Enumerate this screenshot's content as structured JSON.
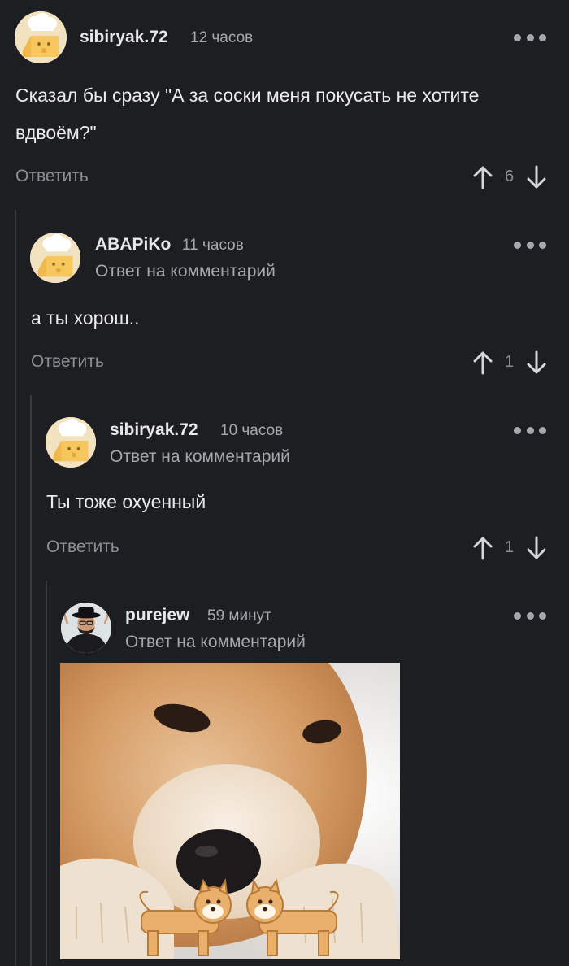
{
  "comments": [
    {
      "username": "sibiryak.72",
      "time": "12 часов",
      "text": "Сказал бы сразу \"А за соски меня покусать не хотите вдвоём?\"",
      "reply_label": "Ответить",
      "score": "6"
    },
    {
      "username": "ABAPiKo",
      "time": "11 часов",
      "reply_to": "Ответ на комментарий",
      "text": "а ты хорош..",
      "reply_label": "Ответить",
      "score": "1"
    },
    {
      "username": "sibiryak.72",
      "time": "10 часов",
      "reply_to": "Ответ на комментарий",
      "text": "Ты тоже охуенный",
      "reply_label": "Ответить",
      "score": "1"
    },
    {
      "username": "purejew",
      "time": "59 минут",
      "reply_to": "Ответ на комментарий",
      "image": "shiba-dog-photo"
    }
  ],
  "icons": {
    "more": "more-dots-icon",
    "upvote": "arrow-up-icon",
    "downvote": "arrow-down-icon"
  },
  "colors": {
    "background": "#1d1e21",
    "muted": "#8e8f94",
    "text": "#ececee"
  }
}
